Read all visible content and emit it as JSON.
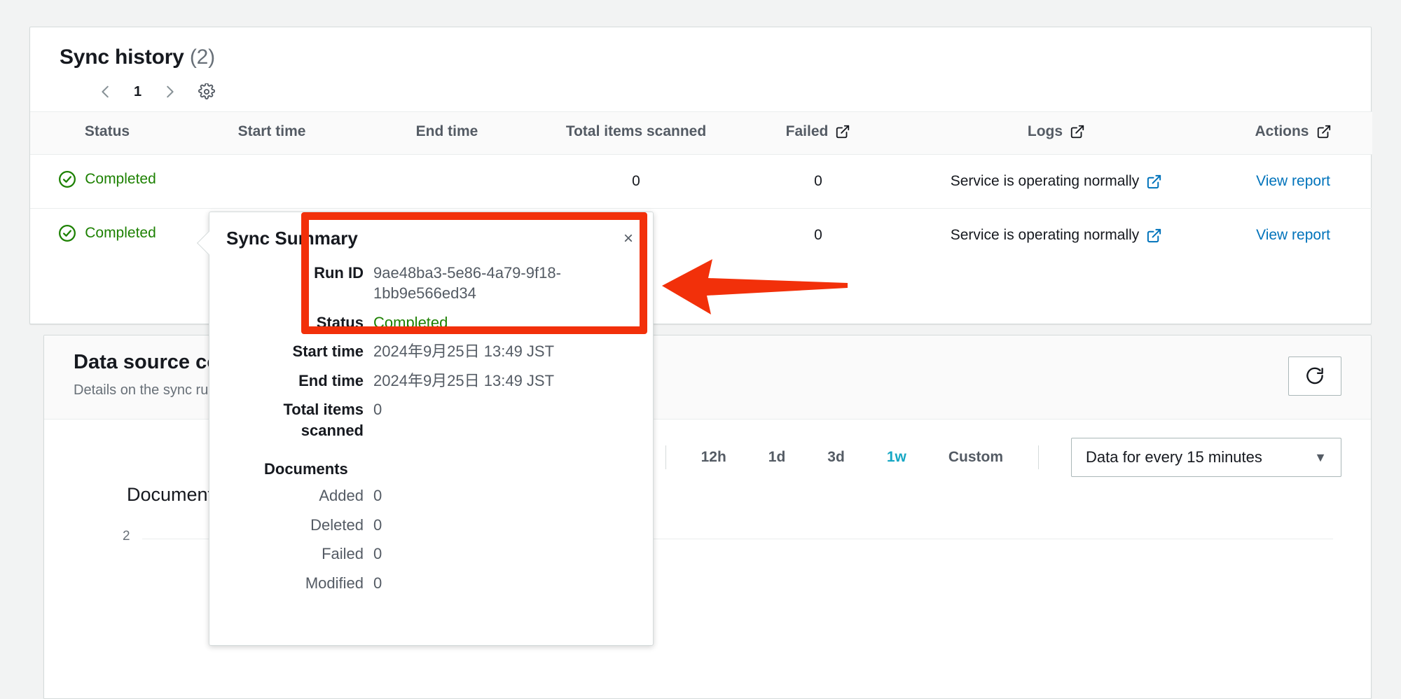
{
  "sync_history": {
    "title": "Sync history",
    "count": "(2)",
    "pagination": {
      "prev": "‹",
      "page": "1",
      "next": "›",
      "settings_icon": "gear-icon"
    },
    "columns": [
      {
        "label": "Status",
        "external": false
      },
      {
        "label": "Start time",
        "external": false
      },
      {
        "label": "End time",
        "external": false
      },
      {
        "label": "Total items scanned",
        "external": false
      },
      {
        "label": "Failed",
        "external": true
      },
      {
        "label": "Logs",
        "external": true
      },
      {
        "label": "Actions",
        "external": true
      }
    ],
    "rows": [
      {
        "status": "Completed",
        "start_time": "",
        "end_time": "",
        "total_items_scanned": "0",
        "failed": "0",
        "logs": "Service is operating normally",
        "action": "View report"
      },
      {
        "status": "Completed",
        "start_time": "",
        "end_time": "",
        "total_items_scanned": "",
        "failed": "0",
        "logs": "Service is operating normally",
        "action": "View report"
      }
    ]
  },
  "popover": {
    "title": "Sync Summary",
    "close_label": "×",
    "run_id_label": "Run ID",
    "run_id_value": "9ae48ba3-5e86-4a79-9f18-1bb9e566ed34",
    "status_label": "Status",
    "status_value": "Completed",
    "start_time_label": "Start time",
    "start_time_value": "2024年9月25日 13:49 JST",
    "end_time_label": "End time",
    "end_time_value": "2024年9月25日 13:49 JST",
    "total_items_label": "Total items scanned",
    "total_items_value": "0",
    "documents_label": "Documents",
    "documents": [
      {
        "label": "Added",
        "value": "0"
      },
      {
        "label": "Deleted",
        "value": "0"
      },
      {
        "label": "Failed",
        "value": "0"
      },
      {
        "label": "Modified",
        "value": "0"
      }
    ]
  },
  "data_source": {
    "title": "Data source co",
    "subtitle": "Details on the sync ru",
    "refresh_icon": "refresh-icon",
    "ranges": [
      {
        "label": "12h",
        "active": false
      },
      {
        "label": "1d",
        "active": false
      },
      {
        "label": "3d",
        "active": false
      },
      {
        "label": "1w",
        "active": true
      }
    ],
    "custom_label": "Custom",
    "interval_select_value": "Data for every 15 minutes",
    "chart_title": "Document s",
    "chart_ytick": "2"
  },
  "annotations": {
    "highlight_color": "#f2300a",
    "rect_name": "run-id-highlight",
    "arrow_name": "red-pointer-arrow"
  },
  "colors": {
    "page_background": "#f2f3f3",
    "link": "#0073bb",
    "success": "#1d8102",
    "active_range": "#16a7c4",
    "muted_text": "#687078"
  }
}
